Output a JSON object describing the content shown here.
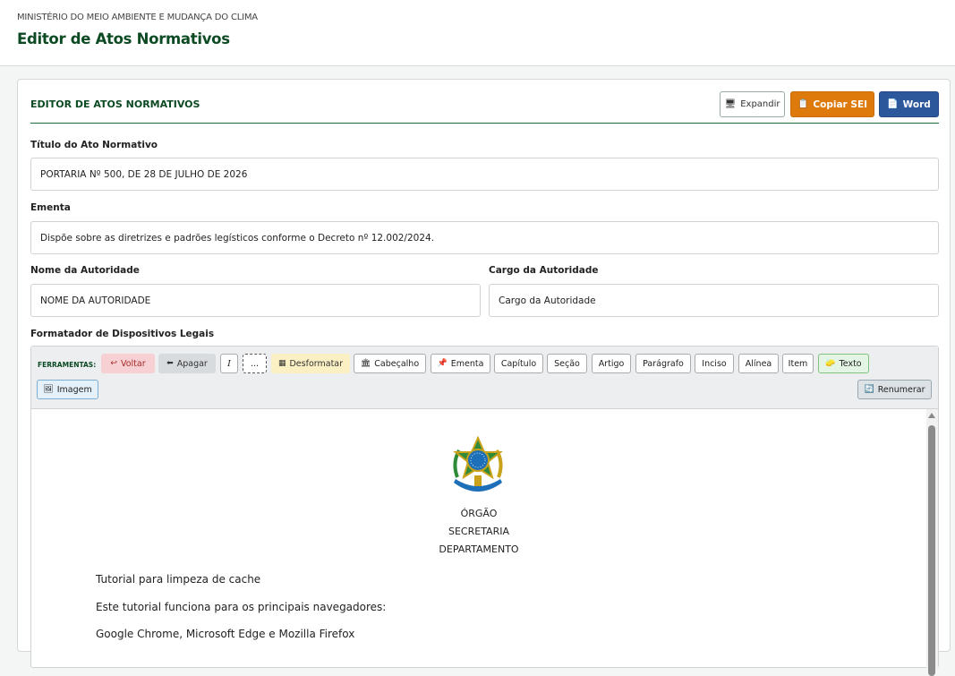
{
  "header": {
    "ministry": "MINISTÉRIO DO MEIO AMBIENTE E MUDANÇA DO CLIMA",
    "title": "Editor de Atos Normativos"
  },
  "card": {
    "title": "EDITOR DE ATOS NORMATIVOS",
    "buttons": {
      "expand": "Expandir",
      "copy_sei": "Copiar SEI",
      "word": "Word"
    }
  },
  "form": {
    "titulo_label": "Título do Ato Normativo",
    "titulo_value": "PORTARIA Nº 500, DE 28 DE JULHO DE 2026",
    "ementa_label": "Ementa",
    "ementa_value": "Dispõe sobre as diretrizes e padrões legísticos conforme o Decreto nº 12.002/2024.",
    "autoridade_label": "Nome da Autoridade",
    "autoridade_value": "NOME DA AUTORIDADE",
    "cargo_label": "Cargo da Autoridade",
    "cargo_value": "Cargo da Autoridade",
    "formatador_label": "Formatador de Dispositivos Legais"
  },
  "toolbar": {
    "label": "FERRAMENTAS:",
    "voltar": "Voltar",
    "apagar": "Apagar",
    "italic": "I",
    "dots": "...",
    "desformatar": "Desformatar",
    "cabecalho": "Cabeçalho",
    "ementa": "Ementa",
    "capitulo": "Capítulo",
    "secao": "Seção",
    "artigo": "Artigo",
    "paragrafo": "Parágrafo",
    "inciso": "Inciso",
    "alinea": "Alínea",
    "item": "Item",
    "texto": "Texto",
    "imagem": "Imagem",
    "renumerar": "Renumerar"
  },
  "document": {
    "orgao": "ÓRGÃO",
    "secretaria": "SECRETARIA",
    "departamento": "DEPARTAMENTO",
    "paragraphs": [
      "Tutorial para limpeza de cache",
      "Este tutorial funciona para os principais navegadores:",
      "Google Chrome, Microsoft Edge e Mozilla Firefox"
    ]
  },
  "colors": {
    "primary_green": "#0c4a23",
    "sei_orange": "#de7a0c",
    "word_blue": "#2c579b"
  }
}
